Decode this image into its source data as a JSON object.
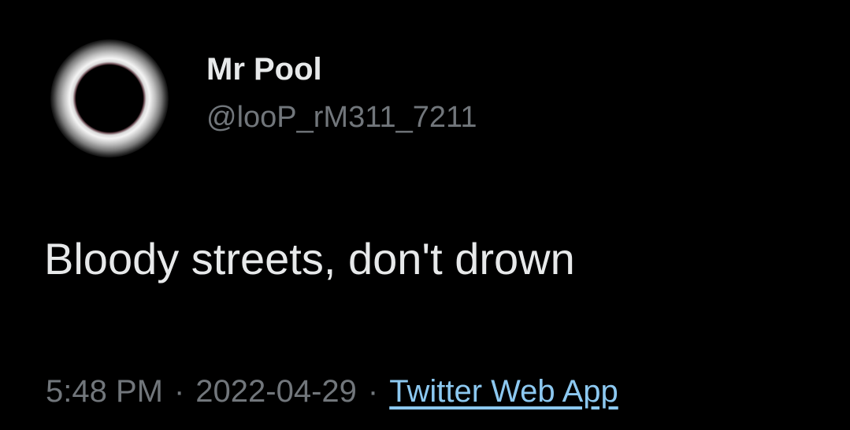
{
  "tweet": {
    "display_name": "Mr Pool",
    "handle": "@looP_rM311_7211",
    "text": "Bloody streets, don't drown",
    "time": "5:48 PM",
    "separator": "·",
    "date": "2022-04-29",
    "source": "Twitter Web App"
  },
  "colors": {
    "background": "#000000",
    "primary_text": "#e7e9ea",
    "secondary_text": "#71767b",
    "link": "#8cc8f0"
  },
  "icons": {
    "avatar": "solar-eclipse-avatar-icon"
  }
}
